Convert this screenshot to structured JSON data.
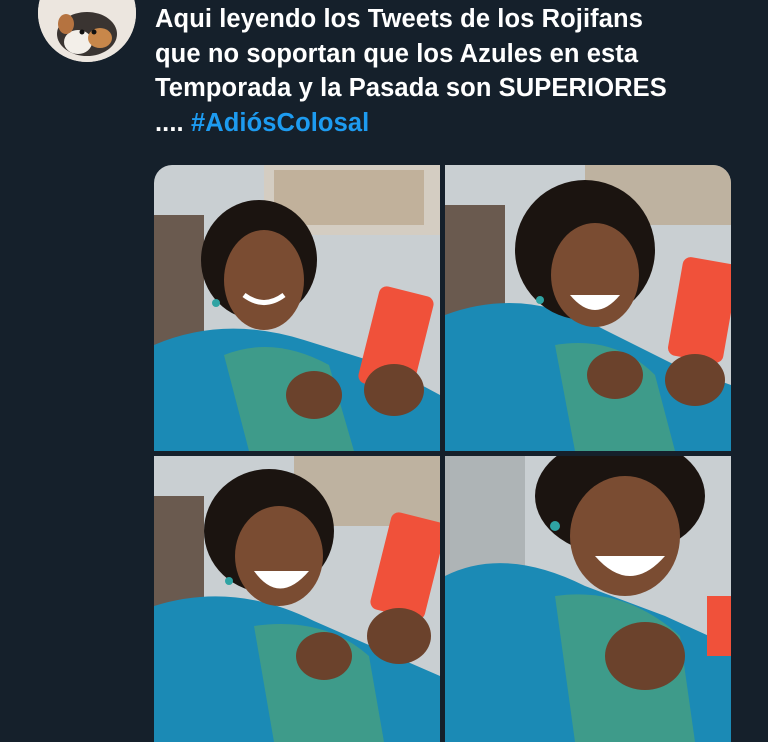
{
  "tweet": {
    "text_lines": [
      "Aqui leyendo los Tweets de los Rojifans",
      "que no soportan que los Azules en esta",
      "Temporada y la Pasada son SUPERIORES"
    ],
    "text_tail": "....",
    "hashtag": "#AdiósColosal"
  },
  "media": {
    "panels": [
      "woman-smiling-at-phone",
      "woman-laughing-at-phone",
      "woman-laughing-harder",
      "woman-laughing-closeup"
    ]
  },
  "colors": {
    "background": "#15202b",
    "text": "#ffffff",
    "hashtag": "#1d9bf0"
  }
}
